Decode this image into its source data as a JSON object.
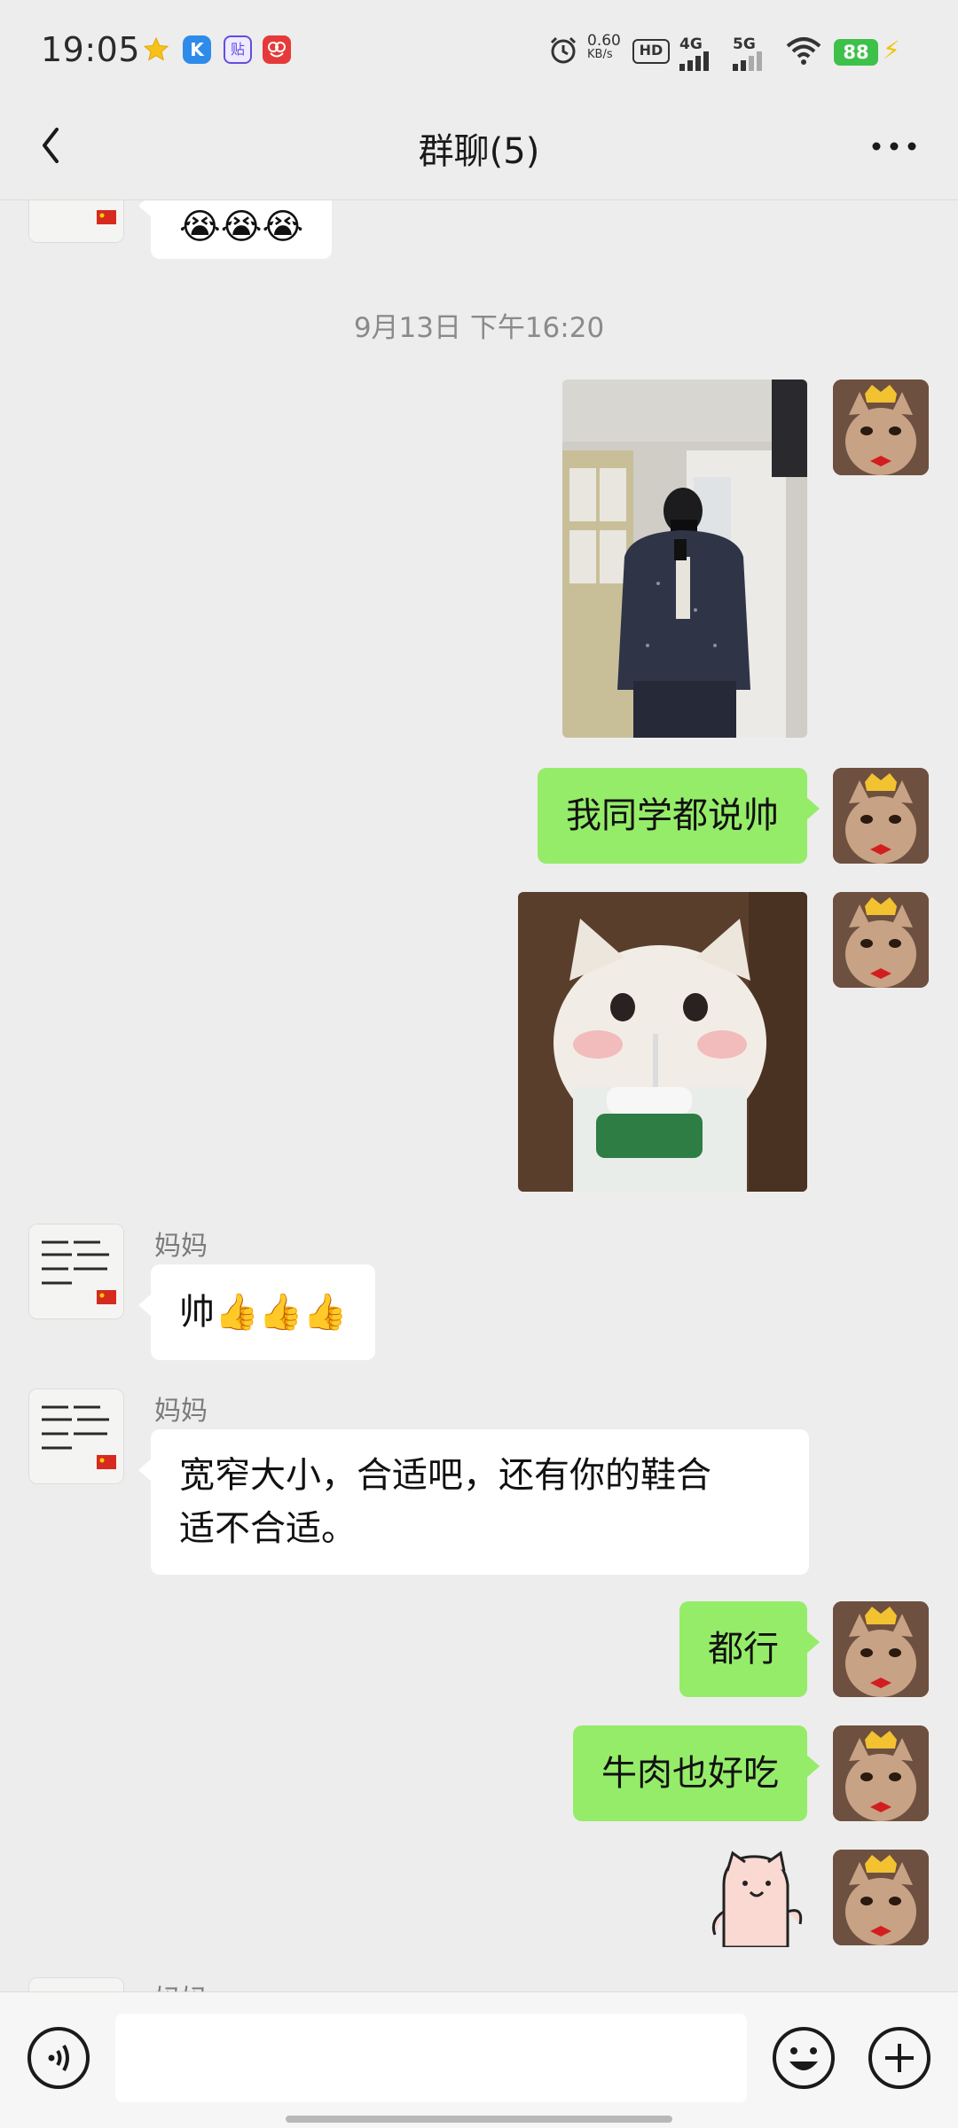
{
  "status_bar": {
    "time": "19:05",
    "net_speed_value": "0.60",
    "net_speed_unit": "KB/s",
    "hd_label": "HD",
    "sig_4g": "4G",
    "sig_5g": "5G",
    "battery": "88",
    "icons": [
      "star-icon",
      "k-app-icon",
      "paste-app-icon",
      "red-app-icon",
      "alarm-icon",
      "hd-icon",
      "signal-4g-icon",
      "signal-5g-icon",
      "wifi-icon",
      "battery-icon",
      "charging-icon"
    ]
  },
  "header": {
    "title": "群聊(5)",
    "back_icon": "chevron-left-icon",
    "more_icon": "more-dots-icon"
  },
  "chat": {
    "timestamp": "9月13日 下午16:20",
    "messages": [
      {
        "side": "left",
        "type": "emoji",
        "content": "😭😭😭"
      },
      {
        "side": "right",
        "type": "image",
        "content": "photo-mirror-selfie"
      },
      {
        "side": "right",
        "type": "text",
        "content": "我同学都说帅"
      },
      {
        "side": "right",
        "type": "image",
        "content": "cat-sticker"
      },
      {
        "side": "left",
        "sender": "妈妈",
        "type": "text",
        "content": "帅👍👍👍"
      },
      {
        "side": "left",
        "sender": "妈妈",
        "type": "text",
        "content": "宽窄大小，合适吧，还有你的鞋合适不合适。"
      },
      {
        "side": "right",
        "type": "text",
        "content": "都行"
      },
      {
        "side": "right",
        "type": "text",
        "content": "牛肉也好吃"
      },
      {
        "side": "right",
        "type": "sticker",
        "content": "pink-cat-sticker"
      },
      {
        "side": "left",
        "sender": "妈妈",
        "type": "partial"
      }
    ],
    "msg_emoji": "😭😭😭",
    "msg_shuai_text": "帅",
    "msg_shuai_emoji": "👍👍👍",
    "msg_classmates": "我同学都说帅",
    "msg_mom_line1": "宽窄大小，合适吧，还有你的鞋合",
    "msg_mom_line2": "适不合适。",
    "msg_dou_xing": "都行",
    "msg_beef": "牛肉也好吃",
    "sender_mom": "妈妈"
  },
  "input_bar": {
    "voice_icon": "voice-icon",
    "emoji_icon": "emoji-icon",
    "plus_icon": "plus-icon",
    "input_value": ""
  }
}
